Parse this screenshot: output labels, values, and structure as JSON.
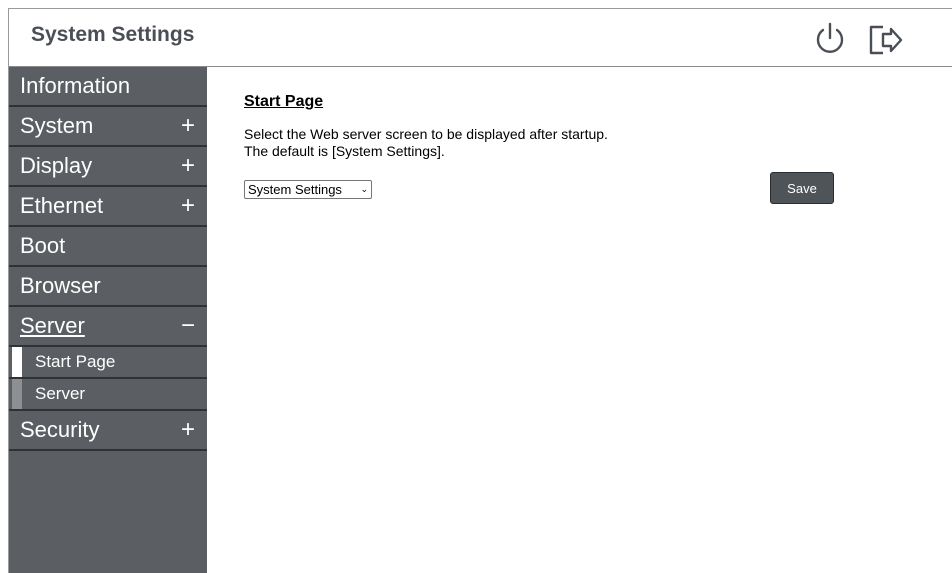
{
  "header": {
    "title": "System Settings",
    "power_icon": "power-icon",
    "logout_icon": "logout-icon"
  },
  "sidebar": {
    "items": [
      {
        "label": "Information",
        "toggle": ""
      },
      {
        "label": "System",
        "toggle": "+"
      },
      {
        "label": "Display",
        "toggle": "+"
      },
      {
        "label": "Ethernet",
        "toggle": "+"
      },
      {
        "label": "Boot",
        "toggle": ""
      },
      {
        "label": "Browser",
        "toggle": ""
      },
      {
        "label": "Server",
        "toggle": "−"
      }
    ],
    "subitems": [
      {
        "label": "Start Page"
      },
      {
        "label": "Server"
      }
    ],
    "last_item": {
      "label": "Security",
      "toggle": "+"
    }
  },
  "main": {
    "title": "Start Page",
    "desc_line1": "Select the Web server screen to be displayed after startup.",
    "desc_line2": "The default is [System Settings].",
    "select_value": "System Settings",
    "save_label": "Save"
  },
  "colors": {
    "sidebar_bg": "#5b5f63",
    "title_text": "#4a4f55",
    "button_bg": "#4f5459"
  }
}
